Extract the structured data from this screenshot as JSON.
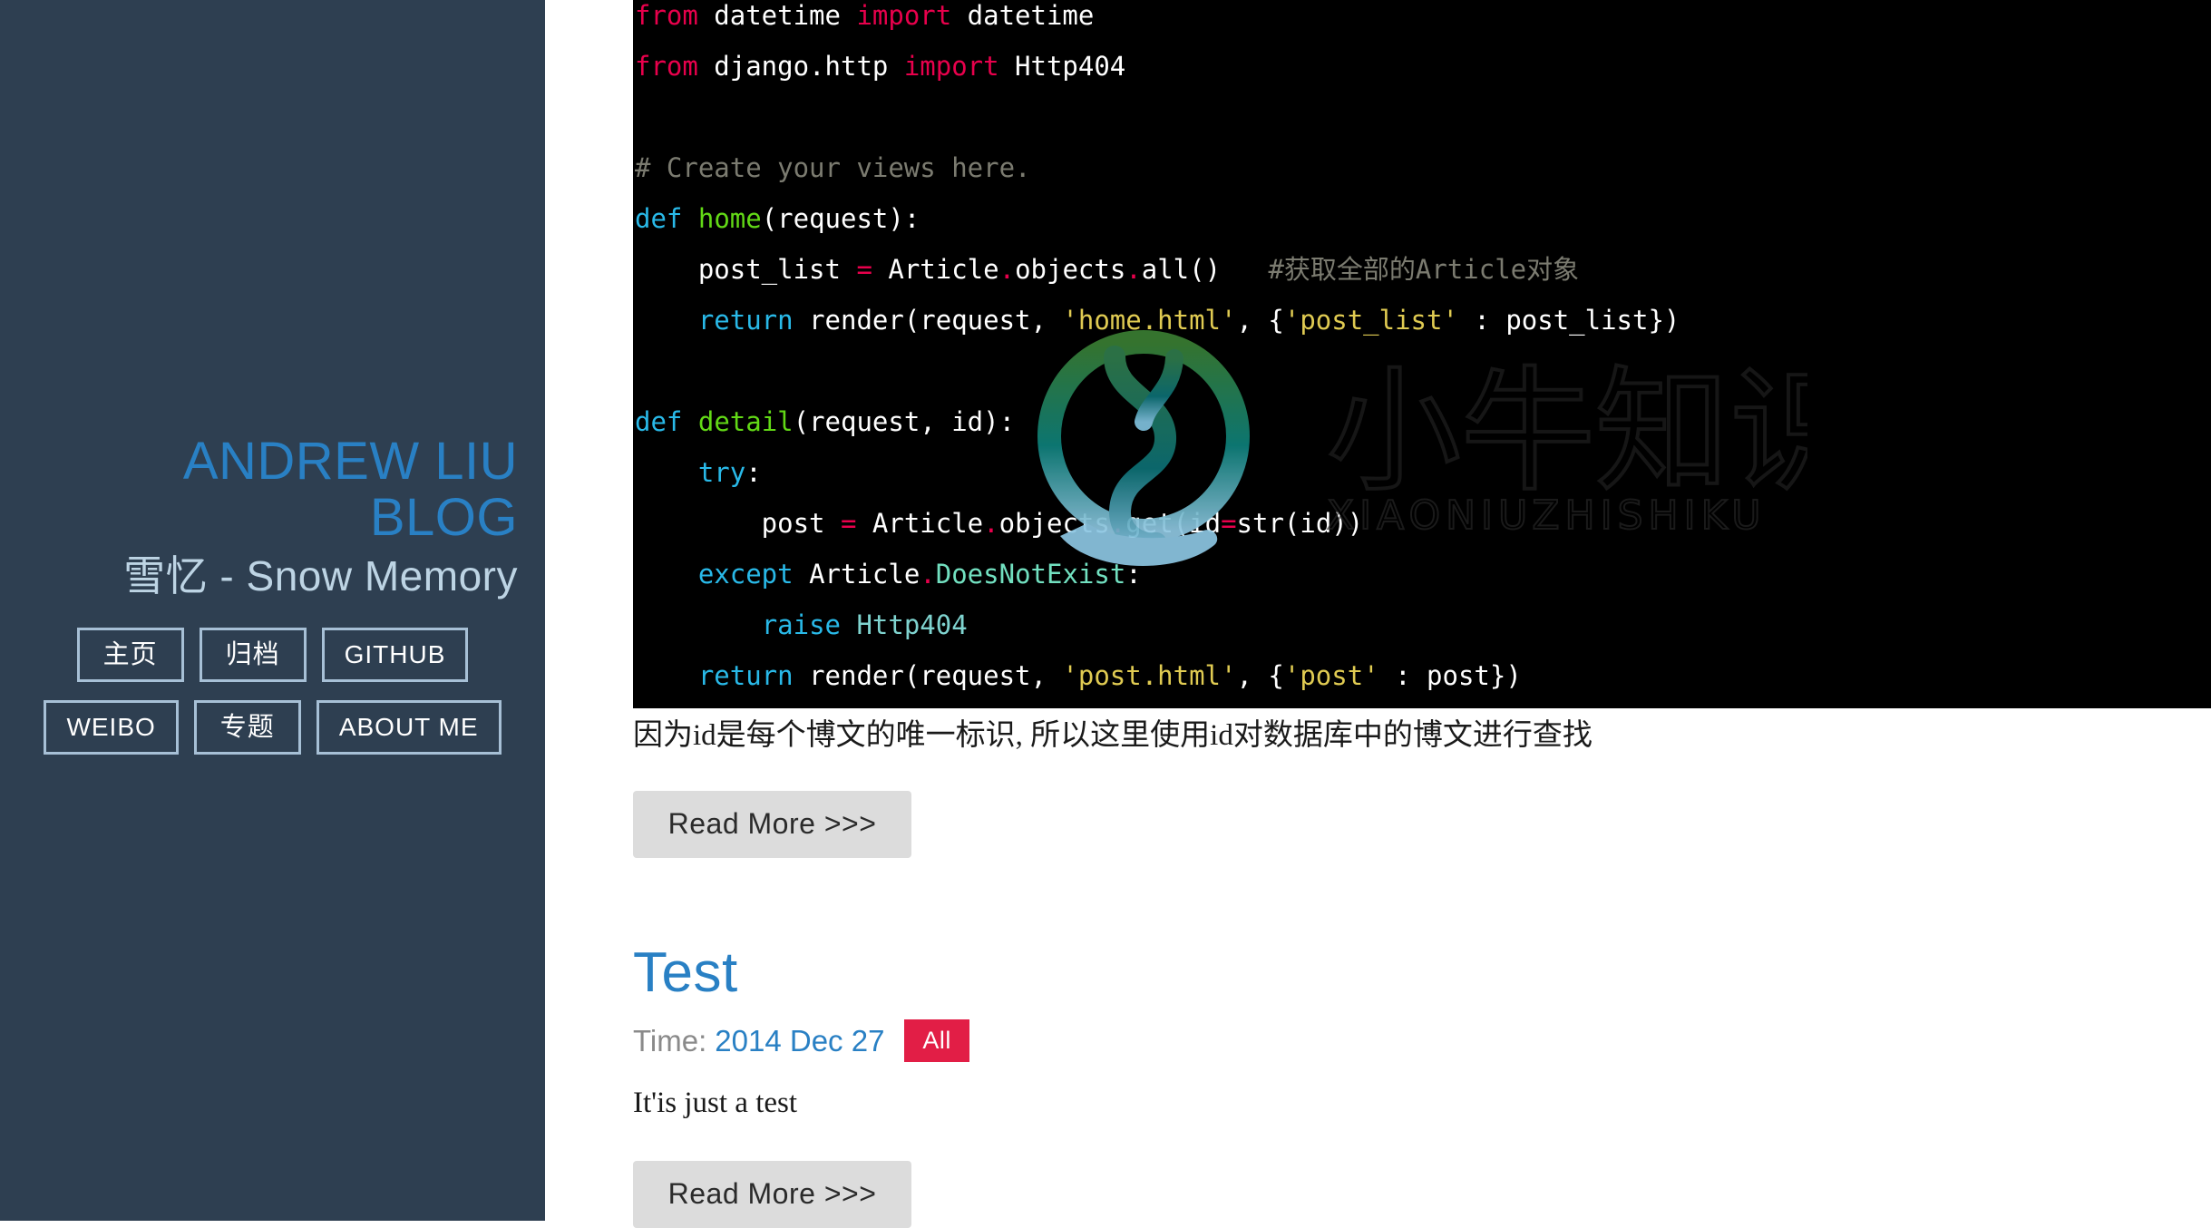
{
  "sidebar": {
    "title_line1": "ANDREW LIU",
    "title_line2": "BLOG",
    "subtitle": "雪忆 - Snow Memory",
    "nav_row1": [
      {
        "label": "主页",
        "name": "nav-home"
      },
      {
        "label": "归档",
        "name": "nav-archive"
      },
      {
        "label": "GITHUB",
        "name": "nav-github"
      }
    ],
    "nav_row2": [
      {
        "label": "WEIBO",
        "name": "nav-weibo"
      },
      {
        "label": "专题",
        "name": "nav-topics"
      },
      {
        "label": "ABOUT ME",
        "name": "nav-about-me"
      }
    ]
  },
  "code": {
    "language": "python",
    "lines": [
      {
        "tokens": [
          {
            "t": "from",
            "c": "kw"
          },
          {
            "t": " datetime ",
            "c": "plain"
          },
          {
            "t": "import",
            "c": "kw"
          },
          {
            "t": " datetime",
            "c": "plain"
          }
        ]
      },
      {
        "tokens": [
          {
            "t": "from",
            "c": "kw"
          },
          {
            "t": " django.http ",
            "c": "plain"
          },
          {
            "t": "import",
            "c": "kw"
          },
          {
            "t": " Http404",
            "c": "plain"
          }
        ]
      },
      {
        "tokens": []
      },
      {
        "tokens": [
          {
            "t": "# Create your views here.",
            "c": "cmt"
          }
        ]
      },
      {
        "tokens": [
          {
            "t": "def",
            "c": "def"
          },
          {
            "t": " ",
            "c": "plain"
          },
          {
            "t": "home",
            "c": "fn"
          },
          {
            "t": "(request):",
            "c": "plain"
          }
        ]
      },
      {
        "tokens": [
          {
            "t": "    post_list ",
            "c": "plain"
          },
          {
            "t": "=",
            "c": "dot"
          },
          {
            "t": " Article",
            "c": "plain"
          },
          {
            "t": ".",
            "c": "dot"
          },
          {
            "t": "objects",
            "c": "plain"
          },
          {
            "t": ".",
            "c": "dot"
          },
          {
            "t": "all()",
            "c": "plain"
          },
          {
            "t": "   #获取全部的Article对象",
            "c": "cmt"
          }
        ]
      },
      {
        "tokens": [
          {
            "t": "    ",
            "c": "plain"
          },
          {
            "t": "return",
            "c": "def"
          },
          {
            "t": " render(request, ",
            "c": "plain"
          },
          {
            "t": "'home.html'",
            "c": "str"
          },
          {
            "t": ", {",
            "c": "plain"
          },
          {
            "t": "'post_list'",
            "c": "str"
          },
          {
            "t": " : post_list})",
            "c": "plain"
          }
        ]
      },
      {
        "tokens": []
      },
      {
        "tokens": [
          {
            "t": "def",
            "c": "def"
          },
          {
            "t": " ",
            "c": "plain"
          },
          {
            "t": "detail",
            "c": "fn"
          },
          {
            "t": "(request, id):",
            "c": "plain"
          }
        ]
      },
      {
        "tokens": [
          {
            "t": "    ",
            "c": "plain"
          },
          {
            "t": "try",
            "c": "def"
          },
          {
            "t": ":",
            "c": "plain"
          }
        ]
      },
      {
        "tokens": [
          {
            "t": "        post ",
            "c": "plain"
          },
          {
            "t": "=",
            "c": "dot"
          },
          {
            "t": " Article",
            "c": "plain"
          },
          {
            "t": ".",
            "c": "dot"
          },
          {
            "t": "objects",
            "c": "plain"
          },
          {
            "t": ".",
            "c": "dot"
          },
          {
            "t": "get(id",
            "c": "plain"
          },
          {
            "t": "=",
            "c": "dot"
          },
          {
            "t": "str(id))",
            "c": "plain"
          }
        ]
      },
      {
        "tokens": [
          {
            "t": "    ",
            "c": "plain"
          },
          {
            "t": "except",
            "c": "def"
          },
          {
            "t": " Article",
            "c": "plain"
          },
          {
            "t": ".",
            "c": "dot"
          },
          {
            "t": "DoesNotExist",
            "c": "cls"
          },
          {
            "t": ":",
            "c": "plain"
          }
        ]
      },
      {
        "tokens": [
          {
            "t": "        ",
            "c": "plain"
          },
          {
            "t": "raise",
            "c": "def"
          },
          {
            "t": " ",
            "c": "plain"
          },
          {
            "t": "Http404",
            "c": "teal"
          }
        ]
      },
      {
        "tokens": [
          {
            "t": "    ",
            "c": "plain"
          },
          {
            "t": "return",
            "c": "def"
          },
          {
            "t": " render(request, ",
            "c": "plain"
          },
          {
            "t": "'post.html'",
            "c": "str"
          },
          {
            "t": ", {",
            "c": "plain"
          },
          {
            "t": "'post'",
            "c": "str"
          },
          {
            "t": " : post})",
            "c": "plain"
          }
        ]
      }
    ]
  },
  "watermark": {
    "text": "小牛知识库",
    "subtext": "XIAONIUZHISHIKU"
  },
  "posts": [
    {
      "paragraph": "因为id是每个博文的唯一标识, 所以这里使用id对数据库中的博文进行查找",
      "read_more": "Read More >>>"
    },
    {
      "title": "Test",
      "time_label": "Time:",
      "time_value": "2014 Dec 27",
      "category": "All",
      "paragraph": "It'is just a test",
      "read_more": "Read More >>>"
    }
  ],
  "colors": {
    "sidebar_bg": "#2e3f51",
    "accent_blue": "#2980c4",
    "subtitle_blue": "#bdd4e4",
    "badge_red": "#e21e46",
    "button_gray": "#dcdcdc",
    "code_bg": "#000000"
  }
}
